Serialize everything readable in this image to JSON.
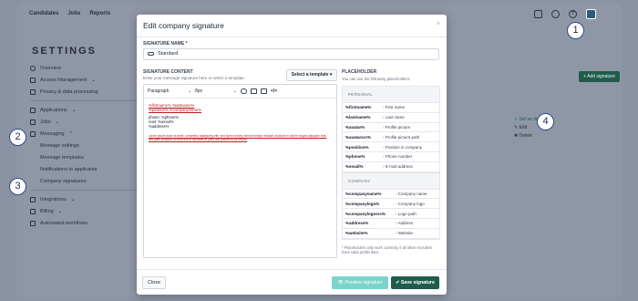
{
  "topnav": {
    "items": [
      "Candidates",
      "Jobs",
      "Reports"
    ]
  },
  "page": {
    "title": "SETTINGS"
  },
  "sidebar": {
    "items": [
      {
        "label": "Overview",
        "icon": "circle-info-icon"
      },
      {
        "label": "Access Management",
        "icon": "key-icon",
        "chevron": "⌄"
      },
      {
        "label": "Privacy & data processing",
        "icon": "lock-icon"
      },
      {
        "label": "Applications",
        "icon": "grid-icon",
        "chevron": "⌄"
      },
      {
        "label": "Jobs",
        "icon": "briefcase-icon",
        "chevron": "⌄"
      },
      {
        "label": "Messaging",
        "icon": "mail-icon",
        "chevron": "⌃"
      }
    ],
    "sub": [
      "Message settings",
      "Message templates",
      "Notifications to applicants",
      "Company signatures"
    ],
    "bottom": [
      {
        "label": "Integrations",
        "icon": "terminal-icon",
        "chevron": "⌄"
      },
      {
        "label": "Billing",
        "icon": "card-icon",
        "chevron": "⌄"
      },
      {
        "label": "Automated workflows",
        "icon": "flow-icon"
      }
    ]
  },
  "right_panel": {
    "add_signature": "+ Add signature",
    "set_default": "✓ Set as default",
    "edit": "✎ Edit",
    "delete": "✖ Delete"
  },
  "callouts": [
    "1",
    "2",
    "3",
    "4"
  ],
  "modal": {
    "title": "Edit company signature",
    "close": "×",
    "name_label": "SIGNATURE NAME *",
    "name_value": "Standard",
    "content_label": "SIGNATURE CONTENT",
    "content_hint": "Enter your message signature here or select a template.",
    "template_button": "Select a template ▾",
    "toolbar": {
      "paragraph": "Paragraph",
      "size": "8px"
    },
    "editor_lines": [
      "%firstname% %lastname%",
      "%position% %companyname%",
      "",
      "phone: %phone%",
      "mail: %email%",
      "%address%"
    ],
    "editor_disclaimer": "Lorem ipsum dolor sit amet, consetetur sadipscing elitr, sed diam nonumy eirmod tempor invidunt ut labore et dolore magna aliquyam erat, sed diam voluptua. At vero eos et accusam et justo duo dolores et ea rebum.",
    "placeholder": {
      "title": "PLACEHOLDER",
      "hint": "You can use the following placeholders:",
      "personal_label": "PERSONAL",
      "personal": [
        {
          "k": "%firstname%",
          "v": "First name"
        },
        {
          "k": "%lastname%",
          "v": "Last name"
        },
        {
          "k": "%avatar%",
          "v": "Profile picture"
        },
        {
          "k": "%avatarsrc%",
          "v": "Profile picture path"
        },
        {
          "k": "%position%",
          "v": "Position in company"
        },
        {
          "k": "%phone%",
          "v": "Phone number"
        },
        {
          "k": "%email%",
          "v": "E-mail address"
        }
      ],
      "company_label": "COMPANY",
      "company": [
        {
          "k": "%companyname%",
          "v": "Company name"
        },
        {
          "k": "%companylogo%",
          "v": "Company logo"
        },
        {
          "k": "%companylogosrc%",
          "v": "Logo path"
        },
        {
          "k": "%address%",
          "v": "Address"
        },
        {
          "k": "%website%",
          "v": "Website"
        }
      ],
      "footnote": "* Placeholders only work correctly, if all other recruiters have valid profile data."
    },
    "footer": {
      "close": "Close",
      "preview": "👁 Preview signature",
      "save": "✔ Save signature"
    }
  }
}
